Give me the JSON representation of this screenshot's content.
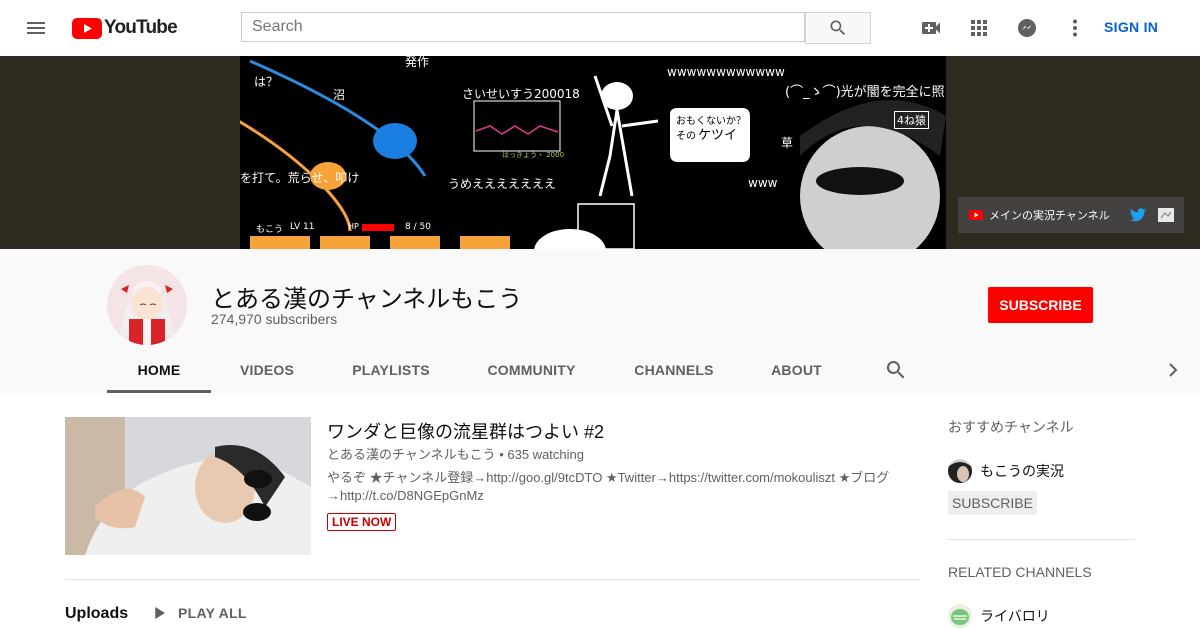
{
  "header": {
    "logo_text": "YouTube",
    "search_placeholder": "Search",
    "sign_in": "SIGN IN",
    "icons": [
      "menu-icon",
      "youtube-logo-icon",
      "search-icon",
      "create-video-icon",
      "apps-grid-icon",
      "messages-icon",
      "more-vert-icon"
    ]
  },
  "banner": {
    "texts": [
      "は？",
      "発作",
      "沼",
      "さいせいすう200018",
      "wwwwwwwwwwww",
      "(⌒_ゝ⌒)光が闇を完全に照",
      "4ね猿",
      "おもくないか？",
      "その",
      "ケツイ",
      "草",
      "www",
      "うめえええええええ",
      "を打て。荒らせ、叩け",
      "もこう",
      "LV 11",
      "HP",
      "8 / 50",
      "はっきょう・ 2000"
    ],
    "links_label": "メインの実況チャンネル"
  },
  "channel": {
    "name": "とある漢のチャンネルもこう",
    "subscribers": "274,970 subscribers",
    "subscribe": "SUBSCRIBE",
    "tabs": [
      "HOME",
      "VIDEOS",
      "PLAYLISTS",
      "COMMUNITY",
      "CHANNELS",
      "ABOUT"
    ],
    "active_tab": "HOME"
  },
  "featured": {
    "title": "ワンダと巨像の流星群はつよい #2",
    "meta": "とある漢のチャンネルもこう • 635 watching",
    "description": "やるぞ ★チャンネル登録→http://goo.gl/9tcDTO ★Twitter→https://twitter.com/mokouliszt ★ブログ→http://t.co/D8NGEpGnMz",
    "live_badge": "LIVE NOW"
  },
  "uploads": {
    "label": "Uploads",
    "play_all": "PLAY ALL"
  },
  "sidebar": {
    "featured_heading": "おすすめチャンネル",
    "featured_channel": "もこうの実況",
    "subscribe": "SUBSCRIBE",
    "related_heading": "RELATED CHANNELS",
    "related_channel": "ライバロリ"
  },
  "colors": {
    "brand_red": "#ff0000",
    "link_blue": "#065fd4",
    "text_secondary": "#606060"
  }
}
